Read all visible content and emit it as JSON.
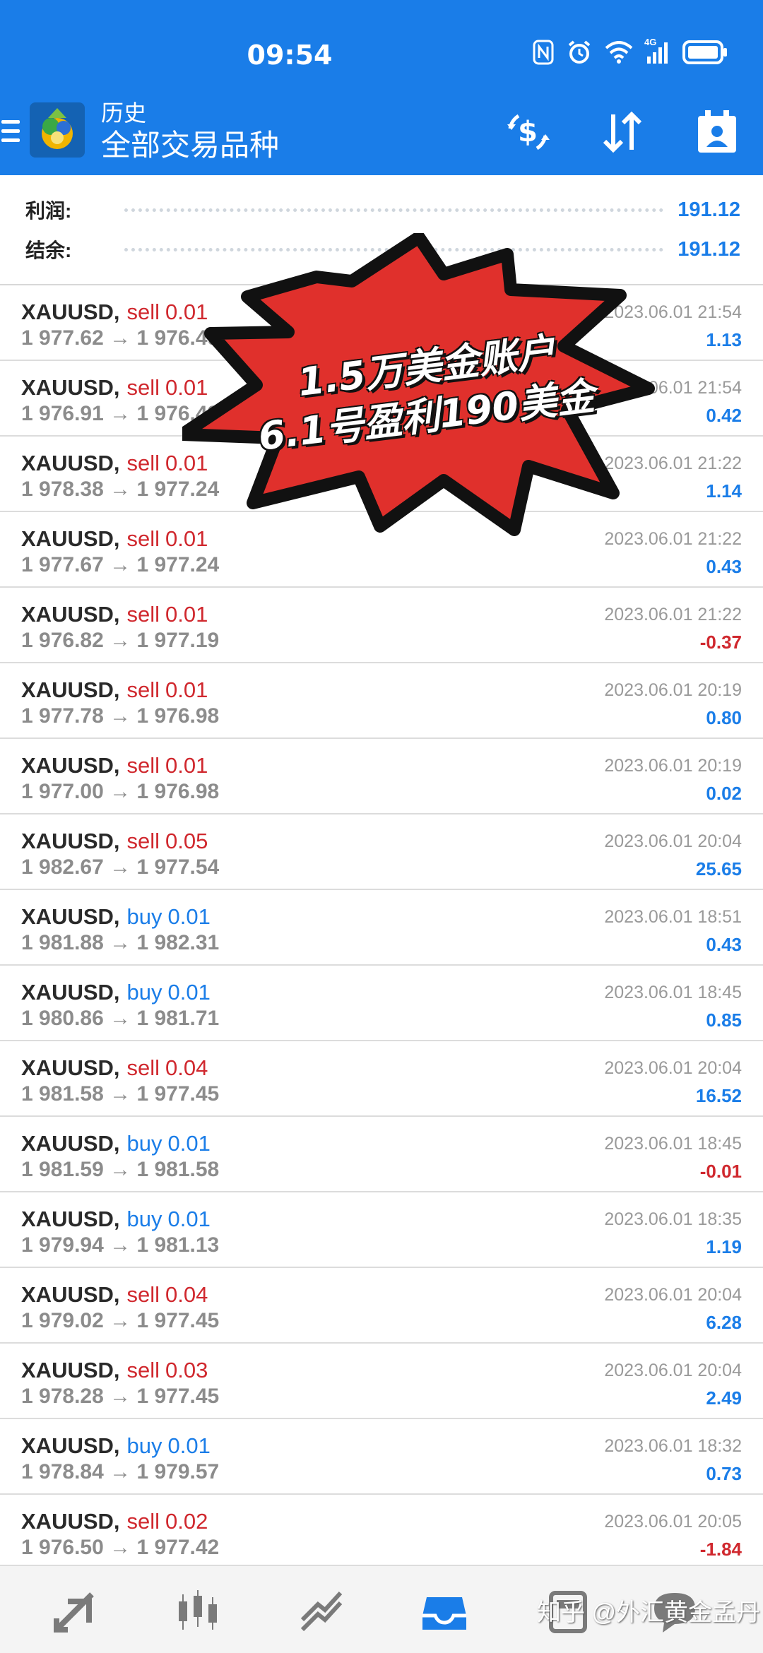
{
  "status_bar": {
    "time": "09:54",
    "network": "4G"
  },
  "header": {
    "title": "历史",
    "subtitle": "全部交易品种"
  },
  "summary": [
    {
      "label": "利润:",
      "value": "191.12"
    },
    {
      "label": "结余:",
      "value": "191.12"
    }
  ],
  "trades": [
    {
      "symbol": "XAUUSD,",
      "side": "sell",
      "lots": "0.01",
      "prices": "1 977.62 → 1 976.49",
      "time": "2023.06.01 21:54",
      "profit": "1.13"
    },
    {
      "symbol": "XAUUSD,",
      "side": "sell",
      "lots": "0.01",
      "prices": "1 976.91 → 1 976.49",
      "time": "2023.06.01 21:54",
      "profit": "0.42"
    },
    {
      "symbol": "XAUUSD,",
      "side": "sell",
      "lots": "0.01",
      "prices": "1 978.38 → 1 977.24",
      "time": "2023.06.01 21:22",
      "profit": "1.14"
    },
    {
      "symbol": "XAUUSD,",
      "side": "sell",
      "lots": "0.01",
      "prices": "1 977.67 → 1 977.24",
      "time": "2023.06.01 21:22",
      "profit": "0.43"
    },
    {
      "symbol": "XAUUSD,",
      "side": "sell",
      "lots": "0.01",
      "prices": "1 976.82 → 1 977.19",
      "time": "2023.06.01 21:22",
      "profit": "-0.37"
    },
    {
      "symbol": "XAUUSD,",
      "side": "sell",
      "lots": "0.01",
      "prices": "1 977.78 → 1 976.98",
      "time": "2023.06.01 20:19",
      "profit": "0.80"
    },
    {
      "symbol": "XAUUSD,",
      "side": "sell",
      "lots": "0.01",
      "prices": "1 977.00 → 1 976.98",
      "time": "2023.06.01 20:19",
      "profit": "0.02"
    },
    {
      "symbol": "XAUUSD,",
      "side": "sell",
      "lots": "0.05",
      "prices": "1 982.67 → 1 977.54",
      "time": "2023.06.01 20:04",
      "profit": "25.65"
    },
    {
      "symbol": "XAUUSD,",
      "side": "buy",
      "lots": "0.01",
      "prices": "1 981.88 → 1 982.31",
      "time": "2023.06.01 18:51",
      "profit": "0.43"
    },
    {
      "symbol": "XAUUSD,",
      "side": "buy",
      "lots": "0.01",
      "prices": "1 980.86 → 1 981.71",
      "time": "2023.06.01 18:45",
      "profit": "0.85"
    },
    {
      "symbol": "XAUUSD,",
      "side": "sell",
      "lots": "0.04",
      "prices": "1 981.58 → 1 977.45",
      "time": "2023.06.01 20:04",
      "profit": "16.52"
    },
    {
      "symbol": "XAUUSD,",
      "side": "buy",
      "lots": "0.01",
      "prices": "1 981.59 → 1 981.58",
      "time": "2023.06.01 18:45",
      "profit": "-0.01"
    },
    {
      "symbol": "XAUUSD,",
      "side": "buy",
      "lots": "0.01",
      "prices": "1 979.94 → 1 981.13",
      "time": "2023.06.01 18:35",
      "profit": "1.19"
    },
    {
      "symbol": "XAUUSD,",
      "side": "sell",
      "lots": "0.04",
      "prices": "1 979.02 → 1 977.45",
      "time": "2023.06.01 20:04",
      "profit": "6.28"
    },
    {
      "symbol": "XAUUSD,",
      "side": "sell",
      "lots": "0.03",
      "prices": "1 978.28 → 1 977.45",
      "time": "2023.06.01 20:04",
      "profit": "2.49"
    },
    {
      "symbol": "XAUUSD,",
      "side": "buy",
      "lots": "0.01",
      "prices": "1 978.84 → 1 979.57",
      "time": "2023.06.01 18:32",
      "profit": "0.73"
    },
    {
      "symbol": "XAUUSD,",
      "side": "sell",
      "lots": "0.02",
      "prices": "1 976.50 → 1 977.42",
      "time": "2023.06.01 20:05",
      "profit": "-1.84"
    }
  ],
  "overlay": {
    "line1": "1.5万美金账户",
    "line2": "6.1号盈利190美金"
  },
  "watermark": "知乎 @外汇黄金孟丹",
  "bottom_nav": [
    {
      "name": "quotes-icon"
    },
    {
      "name": "chart-icon"
    },
    {
      "name": "trade-icon"
    },
    {
      "name": "history-icon",
      "active": true
    },
    {
      "name": "messages-icon"
    },
    {
      "name": "settings-icon"
    }
  ],
  "colors": {
    "accent": "#1a7de8",
    "sell": "#d0282e",
    "buy": "#1a7de8",
    "burst": "#e0302c"
  }
}
